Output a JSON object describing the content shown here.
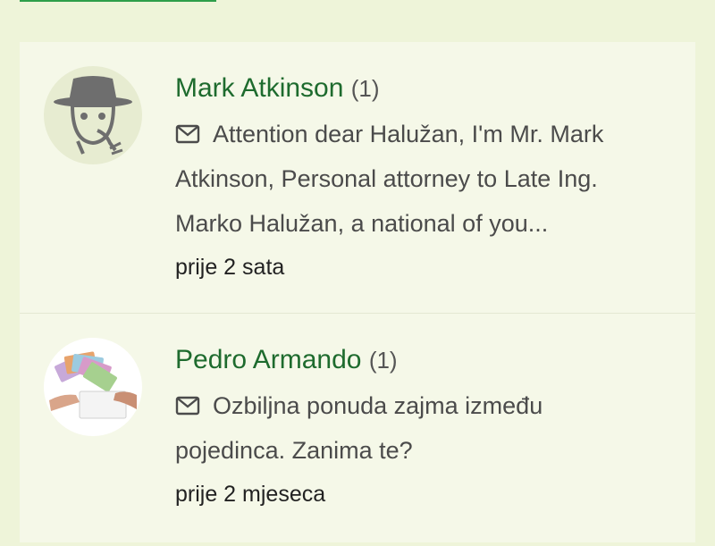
{
  "messages": [
    {
      "sender": "Mark Atkinson",
      "count": "(1)",
      "preview": "Attention dear Halužan, I'm Mr. Mark Atkinson, Personal attorney to Late Ing. Marko Halužan, a national of you...",
      "time": "prije 2 sata",
      "avatar_icon": "spy-hat-avatar-icon"
    },
    {
      "sender": "Pedro Armando",
      "count": "(1)",
      "preview": "Ozbiljna ponuda zajma između pojedinca. Zanima te?",
      "time": "prije 2 mjeseca",
      "avatar_icon": "money-envelope-avatar-icon"
    }
  ],
  "colors": {
    "background": "#eef4d9",
    "card": "#f5f8e8",
    "sender_name": "#1e6b2e",
    "button_border": "#2e9e4a"
  }
}
